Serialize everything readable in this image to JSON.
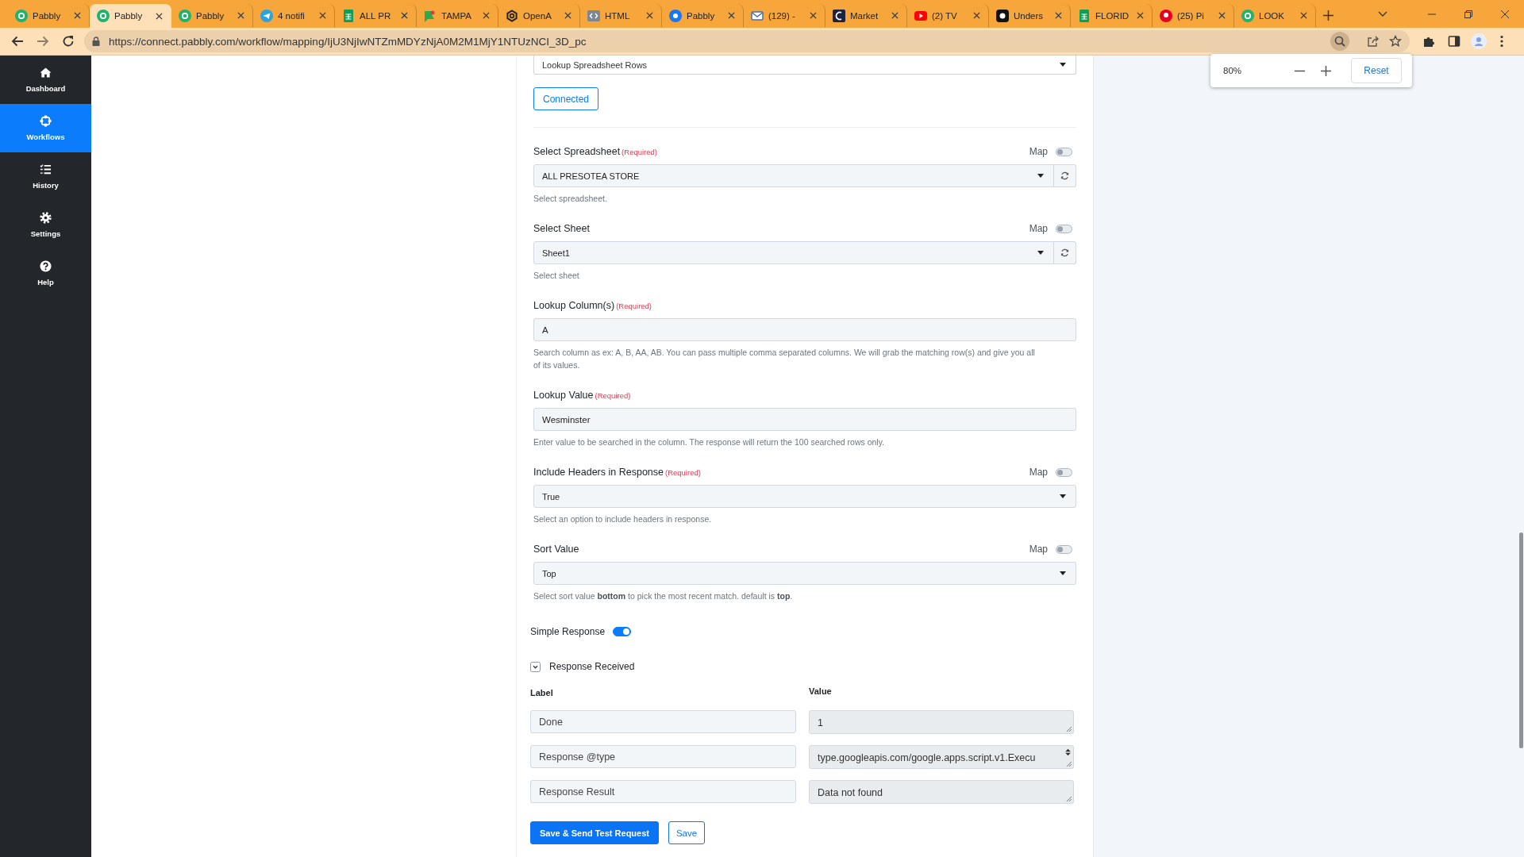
{
  "browser": {
    "tabs": [
      {
        "title": "Pabbly",
        "selected": false
      },
      {
        "title": "Pabbly",
        "selected": true
      },
      {
        "title": "Pabbly",
        "selected": false
      },
      {
        "title": "4 notifi",
        "selected": false
      },
      {
        "title": "ALL PR",
        "selected": false
      },
      {
        "title": "TAMPA",
        "selected": false
      },
      {
        "title": "OpenA",
        "selected": false
      },
      {
        "title": "HTML",
        "selected": false
      },
      {
        "title": "Pabbly",
        "selected": false
      },
      {
        "title": "(129) -",
        "selected": false
      },
      {
        "title": "Market",
        "selected": false
      },
      {
        "title": "(2) TV",
        "selected": false
      },
      {
        "title": "Unders",
        "selected": false
      },
      {
        "title": "FLORID",
        "selected": false
      },
      {
        "title": "(25) Pi",
        "selected": false
      },
      {
        "title": "LOOK",
        "selected": false
      }
    ],
    "url": "https://connect.pabbly.com/workflow/mapping/IjU3NjIwNTZmMDYzNjA0M2M1MjY1NTUzNCI_3D_pc",
    "zoom_popup": {
      "level_text": "80%",
      "reset_button": "Reset"
    }
  },
  "sidebar": {
    "items": [
      {
        "label": "Dashboard",
        "selected": false
      },
      {
        "label": "Workflows",
        "selected": true
      },
      {
        "label": "History",
        "selected": false
      },
      {
        "label": "Settings",
        "selected": false
      },
      {
        "label": "Help",
        "selected": false
      }
    ]
  },
  "form": {
    "action_select": {
      "value": "Lookup Spreadsheet Rows"
    },
    "connection_button": "Connected",
    "fields": [
      {
        "kind": "select",
        "label": "Select Spreadsheet",
        "required": "(Required)",
        "map": {
          "label": "Map",
          "on": false
        },
        "value": "ALL PRESOTEA STORE",
        "refresh": true,
        "help": "Select spreadsheet."
      },
      {
        "kind": "select",
        "label": "Select Sheet",
        "map": {
          "label": "Map",
          "on": false
        },
        "value": "Sheet1",
        "refresh": true,
        "help": "Select sheet"
      },
      {
        "kind": "text",
        "label": "Lookup Column(s)",
        "required": "(Required)",
        "value": "A",
        "refresh": false,
        "help": "Search column as ex: A, B, AA, AB. You can pass multiple comma separated columns. We will grab the matching row(s) and give you all of its values."
      },
      {
        "kind": "text",
        "label": "Lookup Value",
        "required": "(Required)",
        "value": "Wesminster",
        "refresh": false,
        "help": "Enter value to be searched in the column. The response will return the 100 searched rows only."
      },
      {
        "kind": "select",
        "label": "Include Headers in Response",
        "required": "(Required)",
        "map": {
          "label": "Map",
          "on": false
        },
        "value": "True",
        "refresh": false,
        "help": "Select an option to include headers in response."
      },
      {
        "kind": "select",
        "label": "Sort Value",
        "map": {
          "label": "Map",
          "on": false
        },
        "value": "Top",
        "refresh": false,
        "help": "Select sort value **bottom** to pick the most recent match. default is **top**."
      }
    ],
    "simple_response": {
      "label": "Simple Response",
      "on": true
    },
    "response_received": {
      "label": "Response Received",
      "expanded": true
    },
    "response_table": {
      "columns": [
        "Label",
        "Value"
      ],
      "rows": [
        {
          "label": "Done",
          "value": "1",
          "scroll_arrows": false
        },
        {
          "label": "Response @type",
          "value": "type.googleapis.com/google.apps.script.v1.Execu",
          "scroll_arrows": true
        },
        {
          "label": "Response Result",
          "value": "Data not found",
          "scroll_arrows": false
        }
      ]
    },
    "buttons": [
      {
        "label": "Save & Send Test Request",
        "kind": "primary"
      },
      {
        "label": "Save",
        "kind": "outline"
      }
    ]
  }
}
